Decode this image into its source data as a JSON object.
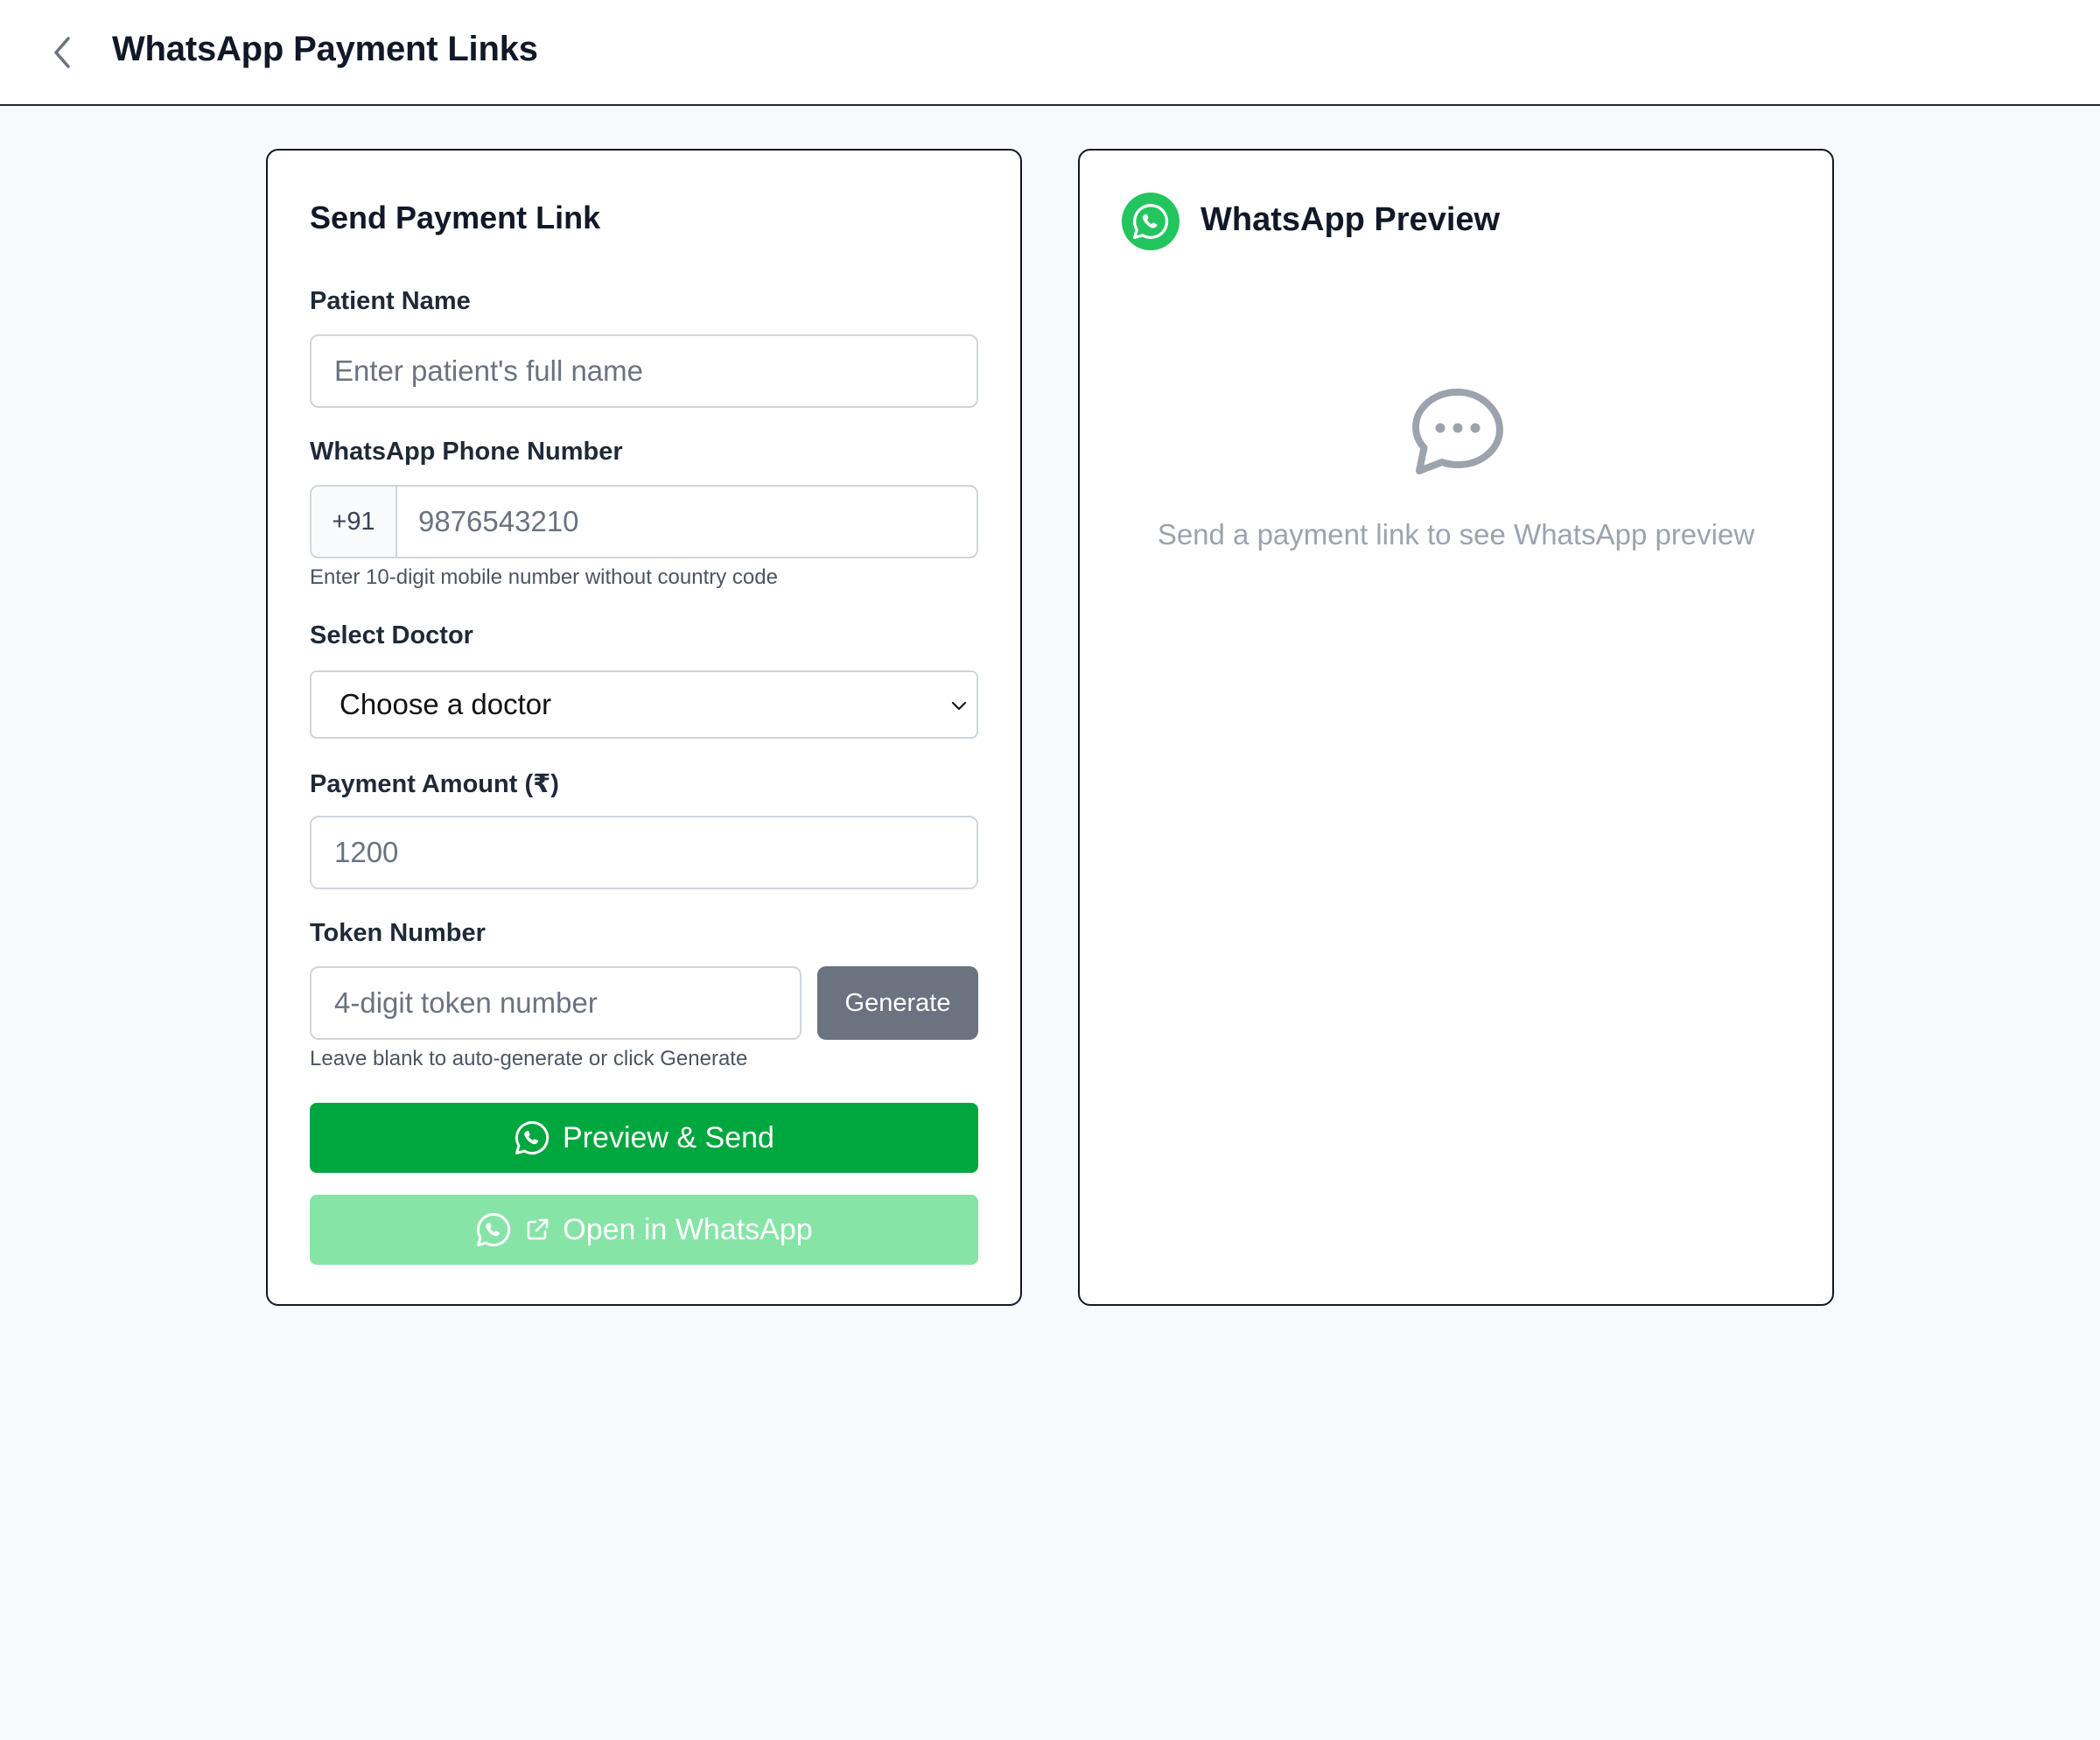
{
  "header": {
    "back_icon": "chevron-left-icon",
    "title": "WhatsApp Payment Links"
  },
  "form": {
    "title": "Send Payment Link",
    "patient_name": {
      "label": "Patient Name",
      "placeholder": "Enter patient's full name",
      "value": ""
    },
    "phone": {
      "label": "WhatsApp Phone Number",
      "prefix": "+91",
      "placeholder": "9876543210",
      "value": "",
      "hint": "Enter 10-digit mobile number without country code"
    },
    "doctor": {
      "label": "Select Doctor",
      "selected": "Choose a doctor"
    },
    "amount": {
      "label": "Payment Amount (₹)",
      "placeholder": "1200",
      "value": ""
    },
    "token": {
      "label": "Token Number",
      "placeholder": "4-digit token number",
      "value": "",
      "generate_label": "Generate",
      "hint": "Leave blank to auto-generate or click Generate"
    },
    "preview_send_label": "Preview & Send",
    "open_whatsapp_label": "Open in WhatsApp"
  },
  "preview": {
    "title": "WhatsApp Preview",
    "icon": "whatsapp-icon",
    "empty_icon": "chat-bubble-icon",
    "empty_text": "Send a payment link to see WhatsApp preview"
  },
  "colors": {
    "primary_green": "#00a63e",
    "disabled_green": "#86e4a7",
    "whatsapp_green": "#22c55e",
    "gray_button": "#6b7280"
  }
}
